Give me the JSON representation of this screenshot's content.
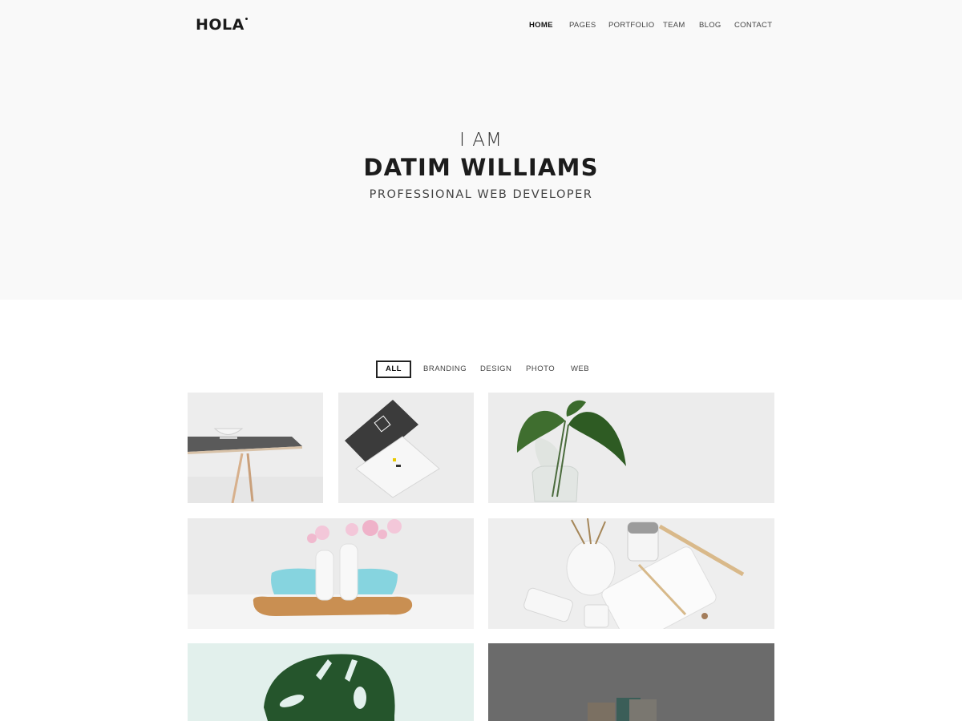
{
  "brand": {
    "logo": "HOLA"
  },
  "nav": {
    "items": [
      "HOME",
      "PAGES",
      "PORTFOLIO",
      "TEAM",
      "BLOG",
      "CONTACT"
    ],
    "active": "HOME"
  },
  "hero": {
    "pre": "I AM",
    "name": "DATIM WILLIAMS",
    "role": "PROFESSIONAL WEB DEVELOPER"
  },
  "portfolio": {
    "filters": [
      "ALL",
      "BRANDING",
      "DESIGN",
      "PHOTO",
      "WEB"
    ],
    "active_filter": "ALL"
  },
  "colors": {
    "hero_bg": "#f9f9f9",
    "text": "#222222",
    "overlay": "#6b6b6b"
  }
}
